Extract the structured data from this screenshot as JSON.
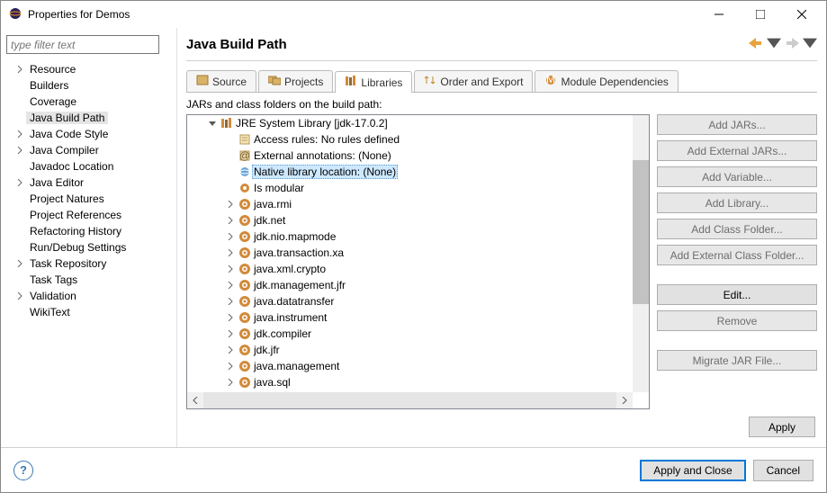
{
  "window": {
    "title": "Properties for Demos"
  },
  "filter": {
    "placeholder": "type filter text"
  },
  "categories": [
    {
      "label": "Resource",
      "expandable": true,
      "selected": false
    },
    {
      "label": "Builders",
      "expandable": false,
      "indent": true
    },
    {
      "label": "Coverage",
      "expandable": false,
      "indent": true
    },
    {
      "label": "Java Build Path",
      "expandable": false,
      "indent": true,
      "selected": true
    },
    {
      "label": "Java Code Style",
      "expandable": true
    },
    {
      "label": "Java Compiler",
      "expandable": true
    },
    {
      "label": "Javadoc Location",
      "expandable": false,
      "indent": true
    },
    {
      "label": "Java Editor",
      "expandable": true
    },
    {
      "label": "Project Natures",
      "expandable": false,
      "indent": true
    },
    {
      "label": "Project References",
      "expandable": false,
      "indent": true
    },
    {
      "label": "Refactoring History",
      "expandable": false,
      "indent": true
    },
    {
      "label": "Run/Debug Settings",
      "expandable": false,
      "indent": true
    },
    {
      "label": "Task Repository",
      "expandable": true
    },
    {
      "label": "Task Tags",
      "expandable": false,
      "indent": true
    },
    {
      "label": "Validation",
      "expandable": true
    },
    {
      "label": "WikiText",
      "expandable": false,
      "indent": true
    }
  ],
  "page": {
    "title": "Java Build Path"
  },
  "tabs": {
    "source": "Source",
    "projects": "Projects",
    "libraries": "Libraries",
    "order": "Order and Export",
    "module": "Module Dependencies"
  },
  "desc": "JARs and class folders on the build path:",
  "tree": {
    "root": "JRE System Library [jdk-17.0.2]",
    "access": "Access rules: No rules defined",
    "ext": "External annotations: (None)",
    "native": "Native library location: (None)",
    "mod": "Is modular",
    "pkgs": [
      "java.rmi",
      "jdk.net",
      "jdk.nio.mapmode",
      "java.transaction.xa",
      "java.xml.crypto",
      "jdk.management.jfr",
      "java.datatransfer",
      "java.instrument",
      "jdk.compiler",
      "jdk.jfr",
      "java.management",
      "java.sql"
    ]
  },
  "buttons": {
    "addJars": "Add JARs...",
    "addExtJars": "Add External JARs...",
    "addVar": "Add Variable...",
    "addLib": "Add Library...",
    "addClassFolder": "Add Class Folder...",
    "addExtClassFolder": "Add External Class Folder...",
    "edit": "Edit...",
    "remove": "Remove",
    "migrate": "Migrate JAR File..."
  },
  "apply": "Apply",
  "applyClose": "Apply and Close",
  "cancel": "Cancel"
}
